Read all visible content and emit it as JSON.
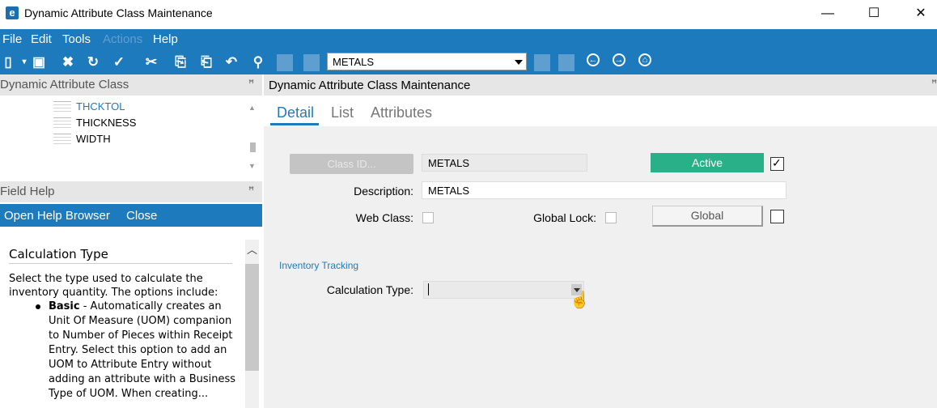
{
  "window": {
    "title": "Dynamic Attribute Class Maintenance",
    "minimize": "—",
    "maximize": "☐",
    "close": "✕"
  },
  "menu": {
    "items": [
      "File",
      "Edit",
      "Tools",
      "Actions",
      "Help"
    ]
  },
  "toolbar": {
    "record_value": "METALS"
  },
  "left_tree": {
    "header": "Dynamic Attribute Class",
    "items": [
      "THCKTOL",
      "THICKNESS",
      "WIDTH"
    ],
    "link_color": "#1d7bbd"
  },
  "field_help": {
    "header": "Field Help",
    "open_browser": "Open Help Browser",
    "close": "Close",
    "title": "Calculation Type",
    "intro": "Select the type used to calculate the inventory quantity. The options include:",
    "bullet_bold": "Basic",
    "bullet_text": " - Automatically creates an Unit Of Measure (UOM) companion to Number of Pieces within Receipt Entry. Select this option to add an UOM to Attribute Entry without adding an attribute with a Business Type of UOM. When creating..."
  },
  "main": {
    "header": "Dynamic Attribute Class Maintenance",
    "tabs": [
      "Detail",
      "List",
      "Attributes"
    ],
    "class_id_button": "Class ID...",
    "class_id_value": "METALS",
    "active_button": "Active",
    "active_checked": true,
    "description_label": "Description:",
    "description_value": "METALS",
    "web_class_label": "Web Class:",
    "global_lock_label": "Global Lock:",
    "global_button": "Global",
    "section_inventory": "Inventory Tracking",
    "calc_type_label": "Calculation Type:",
    "calc_type_value": ""
  },
  "colors": {
    "accent": "#1d7bbd",
    "active_green": "#2ab089"
  }
}
